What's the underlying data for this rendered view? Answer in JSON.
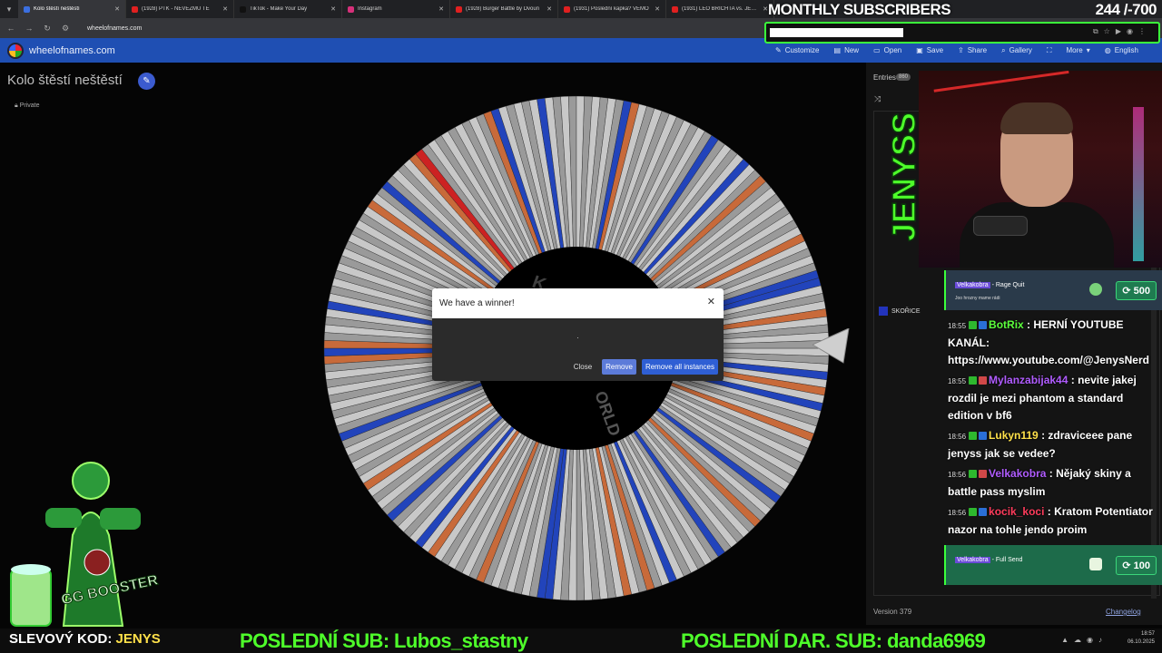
{
  "browser": {
    "tabs": [
      {
        "title": "Kolo štěstí neštěstí",
        "color": "#3b6fe0",
        "active": true
      },
      {
        "title": "(1928) PTK - NEVEZMU TĚ",
        "color": "#e02020"
      },
      {
        "title": "TikTok - Make Your Day",
        "color": "#111111"
      },
      {
        "title": "Instagram",
        "color": "#d6307a"
      },
      {
        "title": "(1928) Burger Battle by Dvoun",
        "color": "#e02020"
      },
      {
        "title": "(1931) Poslední kapka? VĚMO",
        "color": "#e02020"
      },
      {
        "title": "(1931) LEO BRICHTA vs. JENYS",
        "color": "#e02020"
      }
    ],
    "url": "wheelofnames.com"
  },
  "site": {
    "name": "wheelofnames.com",
    "menu": [
      "Customize",
      "New",
      "Open",
      "Save",
      "Share",
      "Gallery",
      "More",
      "English"
    ]
  },
  "page": {
    "title": "Kolo štěstí neštěstí",
    "privacy": "Private"
  },
  "wheel": {
    "slice_count": 200,
    "colors": {
      "base": "#9a9a9a",
      "light": "#c8c8c8",
      "blue": "#2244bb",
      "orange": "#c86a3a",
      "red": "#cc2222",
      "center": "#000000"
    },
    "center_texts": [
      "K",
      "ORLD"
    ]
  },
  "modal": {
    "title": "We have a winner!",
    "winner": "·",
    "close_label": "Close",
    "remove_label": "Remove",
    "remove_all_label": "Remove all instances"
  },
  "sidebar": {
    "entries_label": "Entries",
    "entries_count": "860",
    "visible_entry": "SKOŘICE",
    "version": "Version 379",
    "changelog": "Changelog"
  },
  "overlay": {
    "subs_title": "MONTHLY SUBSCRIBERS",
    "subs_count": "244 /-700",
    "subs_progress": 0.349,
    "logo_text": "JENYSS",
    "redeem1": {
      "user": "Velkakobra",
      "reward": "- Rage Quit",
      "sub": "Joo hrozny mame rádi",
      "cost": "500"
    },
    "redeem2": {
      "user": "Velkakobra",
      "reward": "- Full Send",
      "cost": "100"
    },
    "messages": [
      {
        "time": "18:55",
        "user": "BotRix",
        "color": "#5cff3c",
        "text": ": HERNÍ YOUTUBE KANÁL: https://www.youtube.com/@JenysNerd"
      },
      {
        "time": "18:55",
        "user": "Mylanzabijak44",
        "color": "#b05cff",
        "text": ": nevite jakej rozdil je mezi phantom a standard edition v bf6"
      },
      {
        "time": "18:56",
        "user": "Lukyn119",
        "color": "#ffe14a",
        "text": ": zdraviceee pane jenyss jak se vedee?"
      },
      {
        "time": "18:56",
        "user": "Velkakobra",
        "color": "#b05cff",
        "text": ": Nějaký skiny a battle pass myslim"
      },
      {
        "time": "18:56",
        "user": "kocik_koci",
        "color": "#ff3c5c",
        "text": ": Kratom Potentiator nazor na tohle jendo proim"
      }
    ],
    "mascot_label": "GG BOOSTER"
  },
  "ticker": {
    "code_prefix": "SLEVOVÝ KOD: ",
    "code_value": "JENYS",
    "last_sub": "POSLEDNÍ SUB: Lubos_stastny",
    "last_donation": "POSLEDNÍ DAR. SUB: danda6969",
    "time": "18:57",
    "date": "06.10.2025"
  }
}
